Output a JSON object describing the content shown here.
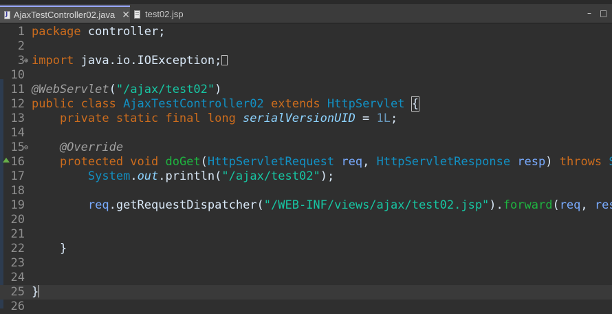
{
  "tabs": [
    {
      "label": "AjaxTestController02.java",
      "close": "✕",
      "active": true
    },
    {
      "label": "test02.jsp",
      "active": false
    }
  ],
  "window_controls": {
    "minimize": "–",
    "maximize": "□"
  },
  "editor": {
    "lines": [
      {
        "n": "1",
        "tokens": [
          [
            "kw",
            "package"
          ],
          [
            "pl",
            " controller;"
          ]
        ]
      },
      {
        "n": "2",
        "tokens": []
      },
      {
        "n": "3",
        "marker": "⊕",
        "tokens": [
          [
            "kw",
            "import"
          ],
          [
            "pl",
            " java.io.IOException;"
          ]
        ],
        "folded": true
      },
      {
        "n": "10",
        "tokens": []
      },
      {
        "n": "11",
        "tokens": [
          [
            "an",
            "@WebServlet"
          ],
          [
            "pl",
            "("
          ],
          [
            "st",
            "\"/ajax/test02\""
          ],
          [
            "pl",
            ")"
          ]
        ]
      },
      {
        "n": "12",
        "tokens": [
          [
            "kw",
            "public class "
          ],
          [
            "ty",
            "AjaxTestController02"
          ],
          [
            "kw",
            " extends "
          ],
          [
            "ty",
            "HttpServlet"
          ],
          [
            "pl",
            " "
          ],
          [
            "brace",
            "{"
          ]
        ]
      },
      {
        "n": "13",
        "tokens": [
          [
            "kw",
            "    private static final long "
          ],
          [
            "fi",
            "serialVersionUID"
          ],
          [
            "pl",
            " = "
          ],
          [
            "nm",
            "1L"
          ],
          [
            "pl",
            ";"
          ]
        ]
      },
      {
        "n": "14",
        "tokens": []
      },
      {
        "n": "15",
        "marker": "⊖",
        "tokens": [
          [
            "an",
            "    @Override"
          ]
        ]
      },
      {
        "n": "16",
        "warn": true,
        "tokens": [
          [
            "kw",
            "    protected void "
          ],
          [
            "mt",
            "doGet"
          ],
          [
            "pl",
            "("
          ],
          [
            "ty",
            "HttpServletRequest"
          ],
          [
            "pl",
            " "
          ],
          [
            "vr",
            "req"
          ],
          [
            "pl",
            ", "
          ],
          [
            "ty",
            "HttpServletResponse"
          ],
          [
            "pl",
            " "
          ],
          [
            "vr",
            "resp"
          ],
          [
            "pl",
            ") "
          ],
          [
            "kw",
            "throws "
          ],
          [
            "ty",
            "Se"
          ]
        ]
      },
      {
        "n": "17",
        "tokens": [
          [
            "pl",
            "        "
          ],
          [
            "ty",
            "System"
          ],
          [
            "pl",
            "."
          ],
          [
            "fi",
            "out"
          ],
          [
            "pl",
            ".println("
          ],
          [
            "st",
            "\"/ajax/test02\""
          ],
          [
            "pl",
            ");"
          ]
        ]
      },
      {
        "n": "18",
        "tokens": []
      },
      {
        "n": "19",
        "tokens": [
          [
            "pl",
            "        "
          ],
          [
            "vr",
            "req"
          ],
          [
            "pl",
            ".getRequestDispatcher("
          ],
          [
            "st",
            "\"/WEB-INF/views/ajax/test02.jsp\""
          ],
          [
            "pl",
            ")."
          ],
          [
            "mt",
            "forward"
          ],
          [
            "pl",
            "("
          ],
          [
            "vr",
            "req"
          ],
          [
            "pl",
            ", "
          ],
          [
            "vr",
            "resp"
          ]
        ]
      },
      {
        "n": "20",
        "tokens": []
      },
      {
        "n": "21",
        "tokens": []
      },
      {
        "n": "22",
        "tokens": [
          [
            "pl",
            "    }"
          ]
        ]
      },
      {
        "n": "23",
        "tokens": []
      },
      {
        "n": "24",
        "tokens": []
      },
      {
        "n": "25",
        "current": true,
        "tokens": [
          [
            "pl",
            "}"
          ],
          [
            "caret",
            ""
          ]
        ]
      },
      {
        "n": "26",
        "tokens": []
      }
    ]
  }
}
